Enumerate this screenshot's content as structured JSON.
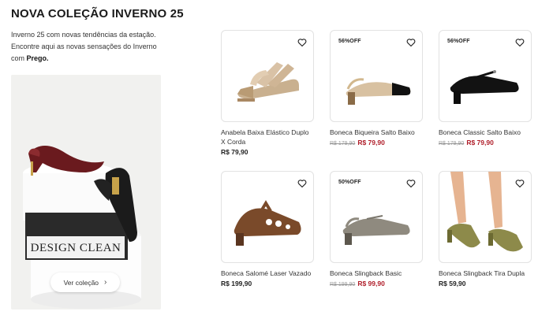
{
  "section": {
    "title": "NOVA COLEÇÃO INVERNO 25",
    "description_text": "Inverno 25 com novas tendências da estação. Encontre aqui as novas sensações do Inverno com ",
    "description_brand": "Prego.",
    "hero_box_text": "DESIGN CLEAN",
    "cta_label": "Ver coleção",
    "cta_icon": "chevron-right-icon"
  },
  "products": [
    {
      "name": "Anabela Baixa Elástico Duplo X Corda",
      "badge": "",
      "old_price": "",
      "price": "R$ 79,90",
      "on_sale": false
    },
    {
      "name": "Boneca Biqueira Salto Baixo",
      "badge": "56%OFF",
      "old_price": "R$ 179,90",
      "price": "R$ 79,90",
      "on_sale": true
    },
    {
      "name": "Boneca Classic Salto Baixo",
      "badge": "56%OFF",
      "old_price": "R$ 179,90",
      "price": "R$ 79,90",
      "on_sale": true
    },
    {
      "name": "Boneca Salomé Laser Vazado",
      "badge": "",
      "old_price": "",
      "price": "R$ 199,90",
      "on_sale": false
    },
    {
      "name": "Boneca Slingback Basic",
      "badge": "50%OFF",
      "old_price": "R$ 199,90",
      "price": "R$ 99,90",
      "on_sale": true
    },
    {
      "name": "Boneca Slingback Tira Dupla",
      "badge": "",
      "old_price": "",
      "price": "R$ 59,90",
      "on_sale": false
    }
  ],
  "colors": {
    "sale_price": "#b01e2a",
    "old_price": "#999999",
    "card_border": "#e2e2e2"
  },
  "icons": {
    "favorite": "heart-outline-icon"
  }
}
